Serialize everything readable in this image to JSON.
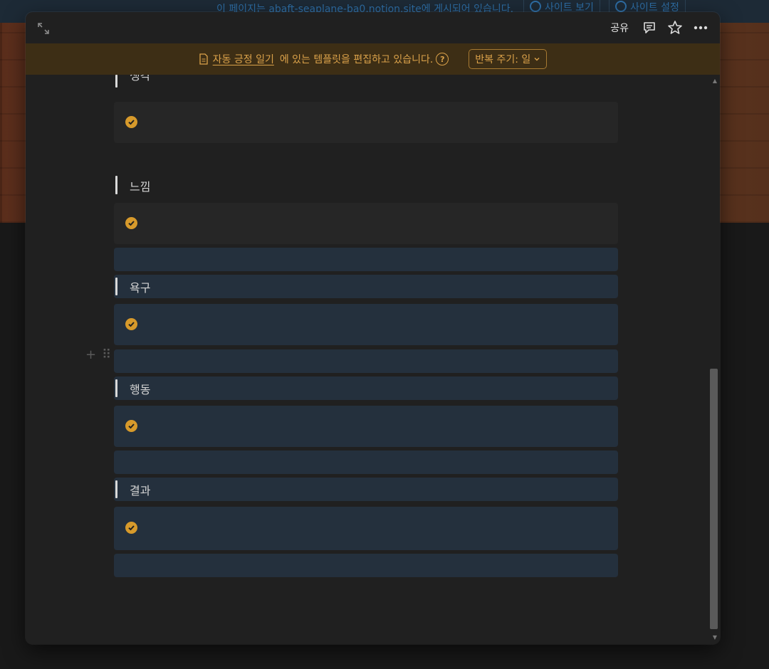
{
  "background": {
    "notice_prefix": "이 페이지는 ",
    "notice_site": "abaft-seaplane-ba0.notion.site",
    "notice_suffix": "에 게시되어 있습니다.",
    "view_site_label": "사이트 보기",
    "site_settings_label": "사이트 설정"
  },
  "toolbar": {
    "share_label": "공유",
    "icons": [
      "expand-icon",
      "comment-icon",
      "star-icon",
      "more-icon"
    ]
  },
  "template_banner": {
    "template_name": "자동 긍정 일기",
    "message": "에 있는 템플릿을 편집하고 있습니다.",
    "help_glyph": "?",
    "repeat_label": "반복 주기: 일"
  },
  "sections": [
    {
      "heading": "생각",
      "checked": true
    },
    {
      "heading": "느낌",
      "checked": true
    },
    {
      "heading": "욕구",
      "checked": true
    },
    {
      "heading": "행동",
      "checked": true
    },
    {
      "heading": "결과",
      "checked": true
    }
  ],
  "colors": {
    "accent": "#d79a2b",
    "banner_bg": "#3d2e15",
    "banner_text": "#dba24a",
    "selected_block": "#24303d",
    "modal_bg": "#202020"
  }
}
